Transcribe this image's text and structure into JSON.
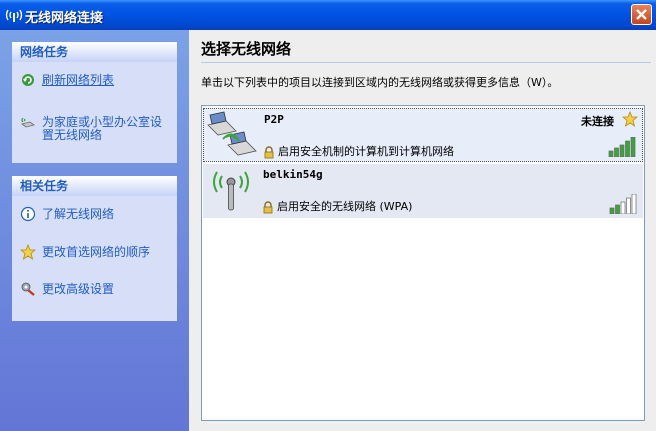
{
  "window": {
    "title": "无线网络连接"
  },
  "left": {
    "network_tasks": {
      "header": "网络任务",
      "items": [
        {
          "label": "刷新网络列表",
          "icon": "refresh-icon"
        },
        {
          "label": "为家庭或小型办公室设置无线网络",
          "icon": "setup-wireless-icon"
        }
      ]
    },
    "related_tasks": {
      "header": "相关任务",
      "items": [
        {
          "label": "了解无线网络",
          "icon": "info-icon"
        },
        {
          "label": "更改首选网络的顺序",
          "icon": "star-icon"
        },
        {
          "label": "更改高级设置",
          "icon": "settings-icon"
        }
      ]
    }
  },
  "main": {
    "heading": "选择无线网络",
    "description": "单击以下列表中的项目以连接到区域内的无线网络或获得更多信息（W）。",
    "networks": [
      {
        "name": "P2P",
        "security": "启用安全机制的计算机到计算机网络",
        "status": "未连接",
        "signal_bars": 5,
        "icon": "ad-hoc-network-icon"
      },
      {
        "name": "belkin54g",
        "security": "启用安全的无线网络 (WPA)",
        "status": "",
        "signal_bars": 2,
        "icon": "access-point-icon"
      }
    ]
  },
  "colors": {
    "link": "#215dc6",
    "signal_on": "#3aa63a",
    "signal_off": "#ffffff"
  }
}
